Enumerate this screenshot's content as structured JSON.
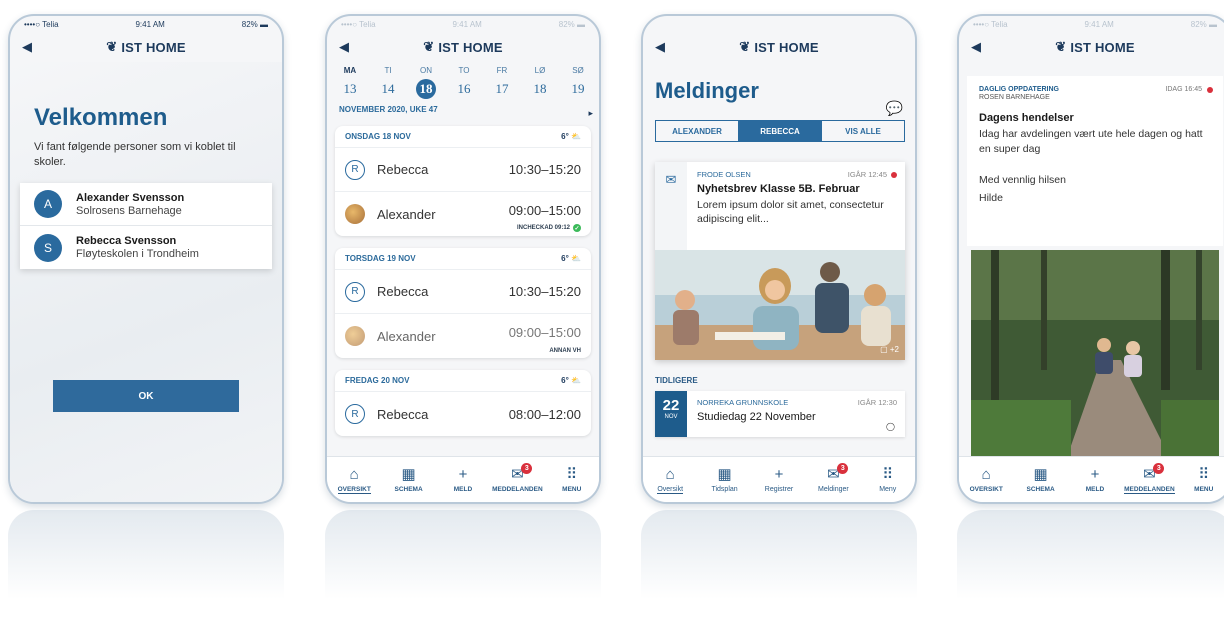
{
  "brand": "IST HOME",
  "phone1": {
    "status": {
      "carrier": "••••○ Telia",
      "time": "9:41 AM",
      "battery": "82%"
    },
    "title": "Velkommen",
    "intro": "Vi fant følgende personer som vi koblet til skoler.",
    "persons": [
      {
        "initial": "A",
        "name": "Alexander Svensson",
        "school": "Solrosens Barnehage"
      },
      {
        "initial": "S",
        "name": "Rebecca Svensson",
        "school": "Fløyteskolen i Trondheim"
      }
    ],
    "ok_label": "OK"
  },
  "phone2": {
    "status": {
      "carrier": "••••○ Telia",
      "time": "9:41 AM",
      "battery": "82%"
    },
    "days": [
      {
        "name": "MA",
        "date": "13"
      },
      {
        "name": "TI",
        "date": "14"
      },
      {
        "name": "ON",
        "date": "18"
      },
      {
        "name": "TO",
        "date": "16"
      },
      {
        "name": "FR",
        "date": "17"
      },
      {
        "name": "LØ",
        "date": "18"
      },
      {
        "name": "SØ",
        "date": "19"
      }
    ],
    "month_label": "NOVEMBER 2020, UKE 47",
    "cards": [
      {
        "head": "ONSDAG 18 NOV",
        "temp": "6°",
        "entries": [
          {
            "name": "Rebecca",
            "time": "10:30–15:20"
          },
          {
            "name": "Alexander",
            "time": "09:00–15:00",
            "note": "INCHECKAD 09:12"
          }
        ]
      },
      {
        "head": "TORSDAG 19 NOV",
        "temp": "6°",
        "entries": [
          {
            "name": "Rebecca",
            "time": "10:30–15:20"
          },
          {
            "name": "Alexander",
            "time": "09:00–15:00",
            "note": "ANNAN VH"
          }
        ]
      },
      {
        "head": "FREDAG 20 NOV",
        "temp": "6°",
        "entries": [
          {
            "name": "Rebecca",
            "time": "08:00–12:00"
          }
        ]
      }
    ],
    "tabs": [
      {
        "label": "OVERSIKT"
      },
      {
        "label": "SCHEMA"
      },
      {
        "label": "MELD"
      },
      {
        "label": "MEDDELANDEN",
        "badge": "3"
      },
      {
        "label": "MENU"
      }
    ]
  },
  "phone3": {
    "title": "Meldinger",
    "segments": [
      "ALEXANDER",
      "REBECCA",
      "VIS ALLE"
    ],
    "message": {
      "sender": "FRODE OLSEN",
      "time": "IGÅR 12:45",
      "title": "Nyhetsbrev Klasse 5B. Februar",
      "text": "Lorem ipsum dolor sit amet, consectetur adipiscing elit...",
      "images": "+2"
    },
    "earlier_label": "TIDLIGERE",
    "earlier": {
      "day": "22",
      "month": "NOV",
      "sender": "NORREKA GRUNNSKOLE",
      "time": "IGÅR 12:30",
      "title": "Studiedag 22 November"
    },
    "tabs": [
      {
        "label": "Oversikt"
      },
      {
        "label": "Tidsplan"
      },
      {
        "label": "Registrer"
      },
      {
        "label": "Meldinger",
        "badge": "3"
      },
      {
        "label": "Meny"
      }
    ]
  },
  "phone4": {
    "status": {
      "carrier": "••••○ Telia",
      "time": "9:41 AM",
      "battery": "82%"
    },
    "update": {
      "kind": "DAGLIG OPPDATERING",
      "time": "IDAG 16:45",
      "place": "ROSEN BARNEHAGE",
      "title": "Dagens hendelser",
      "text": "Idag har avdelingen vært ute hele dagen og hatt en super dag",
      "greeting": "Med vennlig hilsen",
      "signature": "Hilde"
    },
    "tabs": [
      {
        "label": "OVERSIKT"
      },
      {
        "label": "SCHEMA"
      },
      {
        "label": "MELD"
      },
      {
        "label": "MEDDELANDEN",
        "badge": "3"
      },
      {
        "label": "MENU"
      }
    ]
  },
  "colors": {
    "brand_blue": "#1e5c8c",
    "accent": "#2a6a9e",
    "badge_red": "#d9303c",
    "check_green": "#3cba5a"
  }
}
